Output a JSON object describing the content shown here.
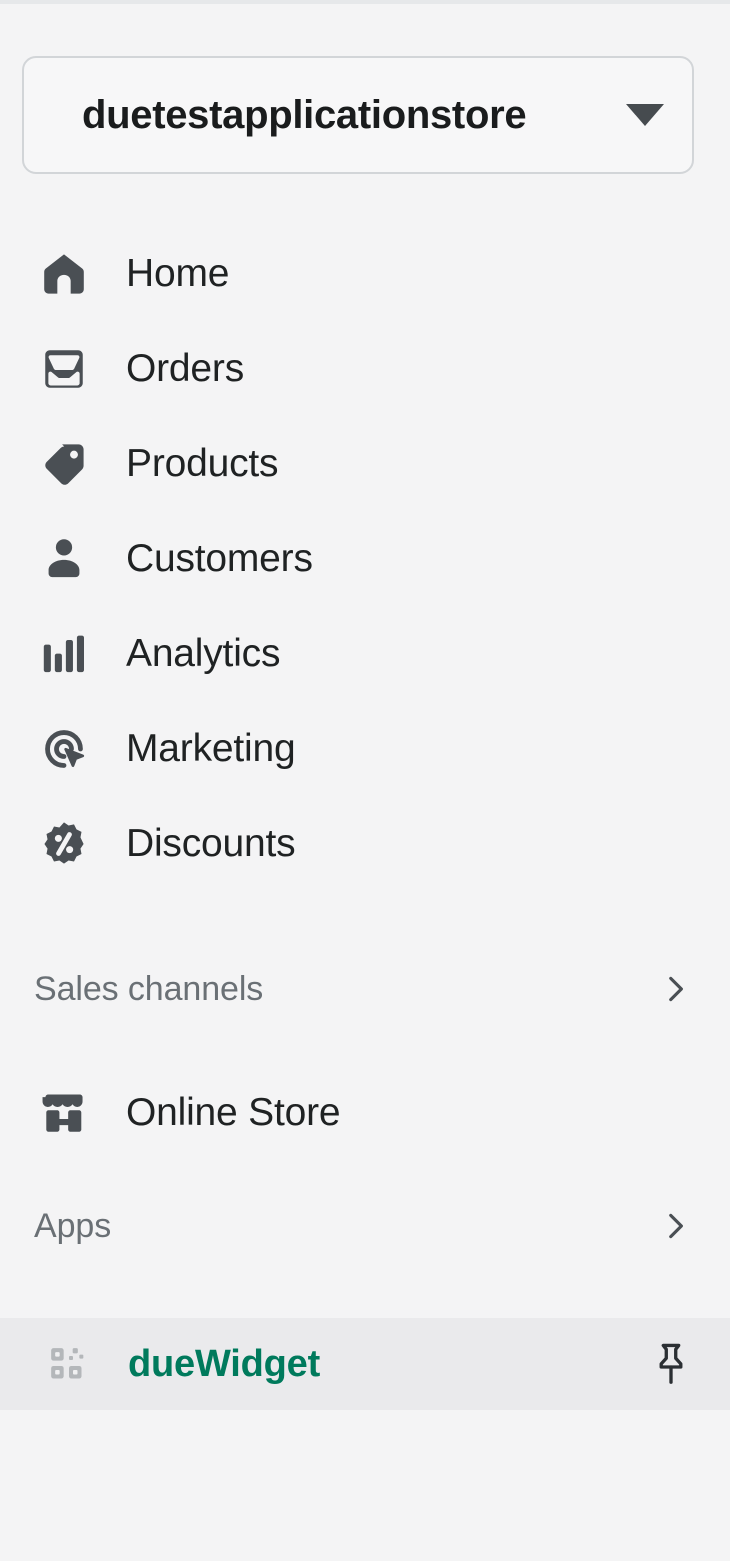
{
  "store_switcher": {
    "name": "duetestapplicationstore",
    "caret_icon": "chevron-down-icon"
  },
  "primary_nav": [
    {
      "label": "Home",
      "icon": "home-icon"
    },
    {
      "label": "Orders",
      "icon": "orders-inbox-icon"
    },
    {
      "label": "Products",
      "icon": "product-tag-icon"
    },
    {
      "label": "Customers",
      "icon": "customer-person-icon"
    },
    {
      "label": "Analytics",
      "icon": "analytics-bars-icon"
    },
    {
      "label": "Marketing",
      "icon": "marketing-target-cursor-icon"
    },
    {
      "label": "Discounts",
      "icon": "discount-percent-badge-icon"
    }
  ],
  "sales_channels": {
    "title": "Sales channels",
    "expand_icon": "chevron-right-icon",
    "items": [
      {
        "label": "Online Store",
        "icon": "storefront-icon"
      }
    ]
  },
  "apps": {
    "title": "Apps",
    "expand_icon": "chevron-right-icon",
    "items": [
      {
        "label": "dueWidget",
        "icon": "app-blocks-icon",
        "pin_icon": "pin-icon",
        "selected": true
      }
    ]
  },
  "colors": {
    "background": "#f4f4f5",
    "selected_row": "#eaeaec",
    "selected_text": "#007a5c",
    "icon_fill": "#4a4f54",
    "nav_text": "#1f2223",
    "section_text": "#6a7075",
    "border": "#d2d5d8"
  }
}
